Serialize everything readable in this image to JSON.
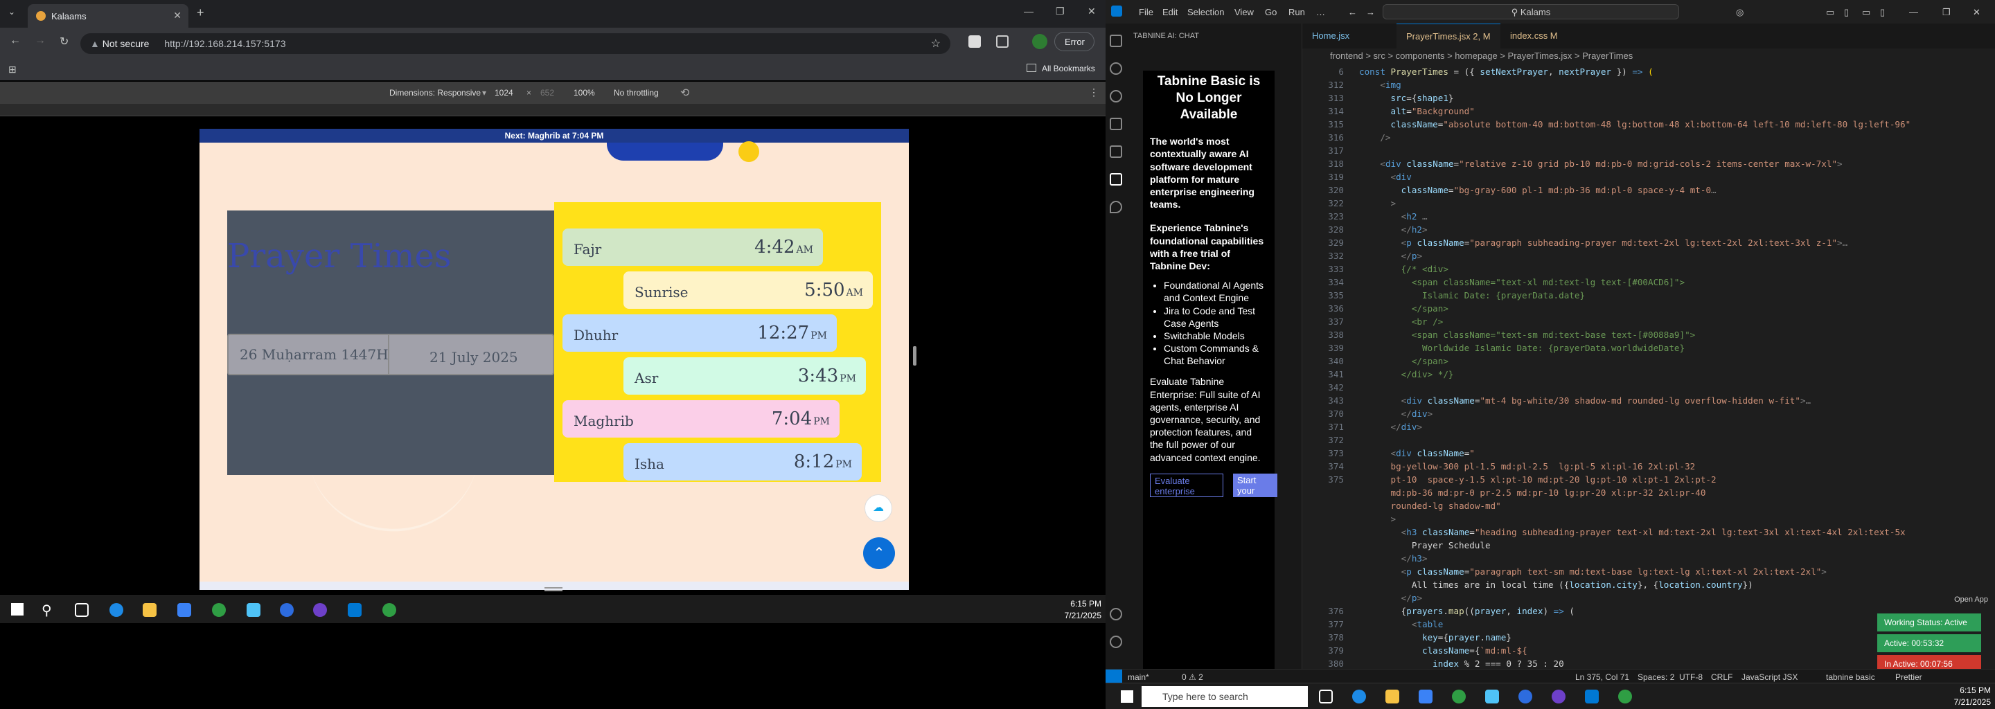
{
  "browser": {
    "tab_title": "Kalaams",
    "security_label": "Not secure",
    "url": "http://192.168.214.157:5173",
    "profile_label": "Error",
    "bookmarks_label": "All Bookmarks",
    "devtools": {
      "dimensions_label": "Dimensions: Responsive",
      "width": "1024",
      "height": "652",
      "zoom": "100%",
      "throttling": "No throttling"
    }
  },
  "site": {
    "next_prayer_text": "Next: Maghrib at 7:04 PM",
    "title": "Prayer Times",
    "hijri_date": "26 Muḥarram 1447H",
    "gregorian_date": "21 July 2025",
    "prayers": [
      {
        "name": "Fajr",
        "time": "4:42",
        "period": "AM",
        "color": "#d1e7c6"
      },
      {
        "name": "Sunrise",
        "time": "5:50",
        "period": "AM",
        "color": "#fef3c7"
      },
      {
        "name": "Dhuhr",
        "time": "12:27",
        "period": "PM",
        "color": "#bfdbfe"
      },
      {
        "name": "Asr",
        "time": "3:43",
        "period": "PM",
        "color": "#d1fae5"
      },
      {
        "name": "Maghrib",
        "time": "7:04",
        "period": "PM",
        "color": "#fbcfe8"
      },
      {
        "name": "Isha",
        "time": "8:12",
        "period": "PM",
        "color": "#bfdbfe"
      }
    ]
  },
  "taskbar_left": {
    "time": "6:15 PM",
    "date": "7/21/2025"
  },
  "vscode": {
    "menu": [
      "File",
      "Edit",
      "Selection",
      "View",
      "Go",
      "Run",
      "…"
    ],
    "search_text": "Kalams",
    "chat_header": "TABNINE AI: CHAT",
    "chat": {
      "heading": "Tabnine Basic is No Longer Available",
      "p1": "The world's most contextually aware AI software development platform for mature enterprise engineering teams.",
      "p2": "Experience Tabnine's foundational capabilities with a free trial of Tabnine Dev:",
      "bullets": [
        "Foundational AI Agents and Context Engine",
        "Jira to Code and Test Case Agents",
        "Switchable Models",
        "Custom Commands & Chat Behavior"
      ],
      "p3": "Evaluate Tabnine Enterprise: Full suite of AI agents, enterprise AI governance, security, and protection features, and the full power of our advanced context engine.",
      "btn1": "Evaluate enterprise",
      "btn2": "Start your Dev trial"
    },
    "tabs": [
      {
        "label": "Home.jsx",
        "active": false
      },
      {
        "label": "PrayerTimes.jsx 2, M",
        "active": true
      },
      {
        "label": "index.css M",
        "active": false
      }
    ],
    "breadcrumb": "frontend > src > components > homepage > PrayerTimes.jsx > PrayerTimes",
    "code_lines": [
      {
        "n": "6",
        "html": "<span class='t'>const</span> <span class='y'>PrayerTimes</span> = ({ <span class='a'>setNextPrayer</span>, <span class='a'>nextPrayer</span> }) <span class='t'>=&gt;</span> <span class='p'>(</span>"
      },
      {
        "n": "312",
        "html": "    <span class='g'>&lt;</span><span class='t'>img</span>"
      },
      {
        "n": "313",
        "html": "      <span class='a'>src</span>={<span class='a'>shape1</span>}"
      },
      {
        "n": "314",
        "html": "      <span class='a'>alt</span>=<span class='s'>\"Background\"</span>"
      },
      {
        "n": "315",
        "html": "      <span class='a'>className</span>=<span class='s'>\"absolute bottom-40 md:bottom-48 lg:bottom-48 xl:bottom-64 left-10 md:left-80 lg:left-96\"</span>"
      },
      {
        "n": "316",
        "html": "    <span class='g'>/&gt;</span>"
      },
      {
        "n": "317",
        "html": ""
      },
      {
        "n": "318",
        "html": "    <span class='g'>&lt;</span><span class='t'>div</span> <span class='a'>className</span>=<span class='s'>\"relative z-10 grid pb-10 md:pb-0 md:grid-cols-2 items-center max-w-7xl\"</span><span class='g'>&gt;</span>"
      },
      {
        "n": "319",
        "html": "      <span class='g'>&lt;</span><span class='t'>div</span>"
      },
      {
        "n": "320",
        "html": "        <span class='a'>className</span>=<span class='s'>\"bg-gray-600 pl-1 md:pb-36 md:pl-0 space-y-4 mt-0</span><span class='g'>…</span>"
      },
      {
        "n": "322",
        "html": "      <span class='g'>&gt;</span>"
      },
      {
        "n": "323",
        "html": "        <span class='g'>&lt;</span><span class='t'>h2</span><span class='g'> …</span>"
      },
      {
        "n": "328",
        "html": "        <span class='g'>&lt;/</span><span class='t'>h2</span><span class='g'>&gt;</span>"
      },
      {
        "n": "329",
        "html": "        <span class='g'>&lt;</span><span class='t'>p</span> <span class='a'>className</span>=<span class='s'>\"paragraph subheading-prayer md:text-2xl lg:text-2xl 2xl:text-3xl z-1\"</span><span class='g'>&gt;…</span>"
      },
      {
        "n": "332",
        "html": "        <span class='g'>&lt;/</span><span class='t'>p</span><span class='g'>&gt;</span>"
      },
      {
        "n": "333",
        "html": "        <span class='c'>{/* &lt;div&gt;</span>"
      },
      {
        "n": "334",
        "html": "<span class='c'>          &lt;span className=\"text-xl md:text-lg text-[#00ACD6]\"&gt;</span>"
      },
      {
        "n": "335",
        "html": "<span class='c'>            Islamic Date: {prayerData.date}</span>"
      },
      {
        "n": "336",
        "html": "<span class='c'>          &lt;/span&gt;</span>"
      },
      {
        "n": "337",
        "html": "<span class='c'>          &lt;br /&gt;</span>"
      },
      {
        "n": "338",
        "html": "<span class='c'>          &lt;span className=\"text-sm md:text-base text-[#0088a9]\"&gt;</span>"
      },
      {
        "n": "339",
        "html": "<span class='c'>            Worldwide Islamic Date: {prayerData.worldwideDate}</span>"
      },
      {
        "n": "340",
        "html": "<span class='c'>          &lt;/span&gt;</span>"
      },
      {
        "n": "341",
        "html": "<span class='c'>        &lt;/div&gt; */}</span>"
      },
      {
        "n": "342",
        "html": ""
      },
      {
        "n": "343",
        "html": "        <span class='g'>&lt;</span><span class='t'>div</span> <span class='a'>className</span>=<span class='s'>\"mt-4 bg-white/30 shadow-md rounded-lg overflow-hidden w-fit\"</span><span class='g'>&gt;…</span>"
      },
      {
        "n": "370",
        "html": "        <span class='g'>&lt;/</span><span class='t'>div</span><span class='g'>&gt;</span>"
      },
      {
        "n": "371",
        "html": "      <span class='g'>&lt;/</span><span class='t'>div</span><span class='g'>&gt;</span>"
      },
      {
        "n": "372",
        "html": ""
      },
      {
        "n": "373",
        "html": "      <span class='g'>&lt;</span><span class='t'>div</span> <span class='a'>className</span>=<span class='s'>\"</span>"
      },
      {
        "n": "374",
        "html": "      <span class='s'>bg-yellow-300 pl-1.5 md:pl-2.5  lg:pl-5 xl:pl-16 2xl:pl-32</span>"
      },
      {
        "n": "375",
        "html": "      <span class='s'>pt-10  space-y-1.5 xl:pt-10 md:pt-20 lg:pt-10 xl:pt-1 2xl:pt-2</span>"
      },
      {
        "n": "",
        "html": "      <span class='s'>md:pb-36 md:pr-0 pr-2.5 md:pr-10 lg:pr-20 xl:pr-32 2xl:pr-40</span>"
      },
      {
        "n": "",
        "html": "      <span class='s'>rounded-lg shadow-md\"</span>"
      },
      {
        "n": "",
        "html": "      <span class='g'>&gt;</span>"
      },
      {
        "n": "",
        "html": "        <span class='g'>&lt;</span><span class='t'>h3</span> <span class='a'>className</span>=<span class='s'>\"heading subheading-prayer text-xl md:text-2xl lg:text-3xl xl:text-4xl 2xl:text-5x</span>"
      },
      {
        "n": "",
        "html": "          Prayer Schedule"
      },
      {
        "n": "",
        "html": "        <span class='g'>&lt;/</span><span class='t'>h3</span><span class='g'>&gt;</span>"
      },
      {
        "n": "",
        "html": "        <span class='g'>&lt;</span><span class='t'>p</span> <span class='a'>className</span>=<span class='s'>\"paragraph text-sm md:text-base lg:text-lg xl:text-xl 2xl:text-2xl\"</span><span class='g'>&gt;</span>"
      },
      {
        "n": "",
        "html": "          All times are in local time ({<span class='a'>location.city</span>}, {<span class='a'>location.country</span>})"
      },
      {
        "n": "",
        "html": "        <span class='g'>&lt;/</span><span class='t'>p</span><span class='g'>&gt;</span>"
      },
      {
        "n": "376",
        "html": "        {<span class='a'>prayers</span>.<span class='y'>map</span>((<span class='a'>prayer</span>, <span class='a'>index</span>) <span class='t'>=&gt;</span> ("
      },
      {
        "n": "377",
        "html": "          <span class='g'>&lt;</span><span class='t'>table</span>"
      },
      {
        "n": "378",
        "html": "            <span class='a'>key</span>={<span class='a'>prayer</span>.<span class='a'>name</span>}"
      },
      {
        "n": "379",
        "html": "            <span class='a'>className</span>={<span class='s'>`md:ml-${</span>"
      },
      {
        "n": "380",
        "html": "              <span class='a'>index</span> % 2 === 0 ? 35 : 20"
      }
    ],
    "status": {
      "branch": "main*",
      "problems": "0 ⚠ 2",
      "cursor": "Ln 375, Col 71",
      "spaces": "Spaces: 2",
      "encoding": "UTF-8",
      "eol": "CRLF",
      "language": "JavaScript JSX",
      "tabnine": "tabnine basic",
      "prettier": "Prettier"
    },
    "overlays": {
      "open_app": "Open App",
      "working_status": "Working Status: Active",
      "active_time": "Active: 00:53:32",
      "inactive_time": "In Active: 00:07:56"
    }
  },
  "taskbar_right": {
    "search_placeholder": "Type here to search",
    "time": "6:15 PM",
    "date": "7/21/2025"
  }
}
